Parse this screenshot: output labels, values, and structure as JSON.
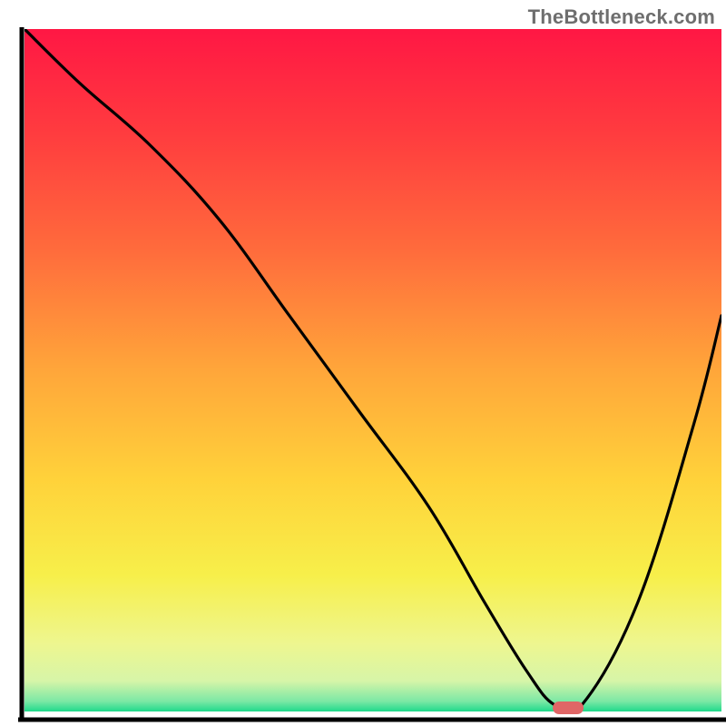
{
  "attribution": "TheBottleneck.com",
  "chart_data": {
    "type": "line",
    "title": "",
    "xlabel": "",
    "ylabel": "",
    "xlim": [
      0,
      100
    ],
    "ylim": [
      0,
      100
    ],
    "x": [
      0,
      8,
      18,
      28,
      38,
      48,
      58,
      66,
      72,
      76,
      80,
      88,
      96,
      100
    ],
    "values": [
      100,
      92,
      83,
      72,
      58,
      44,
      30,
      16,
      6,
      1,
      1,
      16,
      42,
      58
    ],
    "grid": false,
    "annotations": [
      {
        "kind": "marker",
        "shape": "pill",
        "x": 78,
        "color": "#e06666"
      }
    ],
    "background_gradient": {
      "stops": [
        {
          "t": 0.0,
          "color": "#ff1744"
        },
        {
          "t": 0.15,
          "color": "#ff3b3f"
        },
        {
          "t": 0.32,
          "color": "#ff6a3c"
        },
        {
          "t": 0.5,
          "color": "#ffa63a"
        },
        {
          "t": 0.66,
          "color": "#ffd23a"
        },
        {
          "t": 0.8,
          "color": "#f7ef4a"
        },
        {
          "t": 0.9,
          "color": "#eef68f"
        },
        {
          "t": 0.955,
          "color": "#d7f5a8"
        },
        {
          "t": 0.985,
          "color": "#7ce8a5"
        },
        {
          "t": 1.0,
          "color": "#1fd98b"
        }
      ]
    },
    "axis": {
      "left": {
        "x": 3.0
      },
      "bottom": {
        "y": 1.5
      }
    }
  }
}
